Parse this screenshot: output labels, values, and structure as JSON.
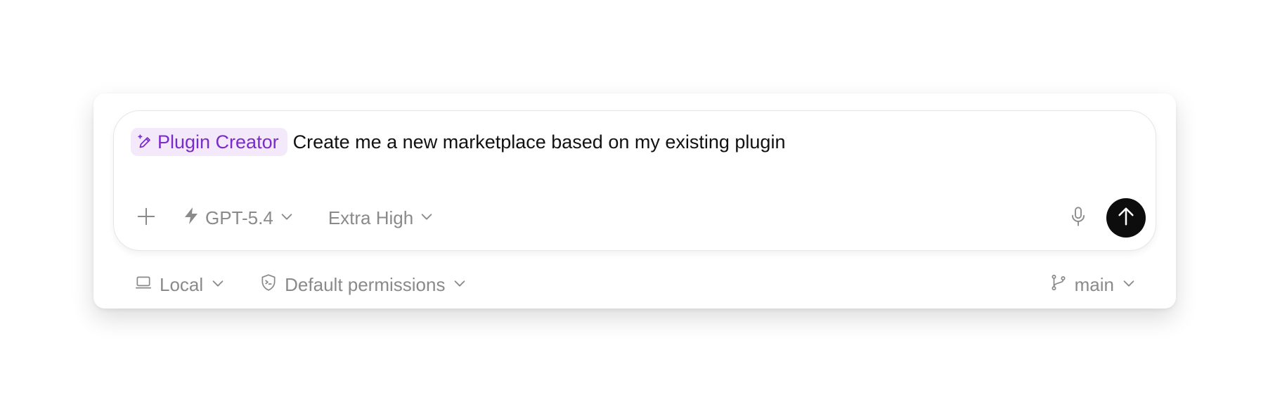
{
  "composer": {
    "skill_chip": {
      "label": "Plugin Creator",
      "icon": "pencil-sparkle-icon"
    },
    "prompt_text": "Create me a new marketplace based on my existing plugin",
    "toolbar": {
      "add_icon": "plus-icon",
      "model": {
        "icon": "bolt-icon",
        "label": "GPT-5.4"
      },
      "reasoning": {
        "label": "Extra High"
      },
      "mic_icon": "microphone-icon",
      "send_icon": "arrow-up-icon"
    }
  },
  "footer": {
    "environment": {
      "icon": "laptop-icon",
      "label": "Local"
    },
    "permissions": {
      "icon": "shield-terminal-icon",
      "label": "Default permissions"
    },
    "branch": {
      "icon": "git-branch-icon",
      "label": "main"
    }
  },
  "colors": {
    "accent_purple": "#7a2cc9",
    "chip_background": "#f3e9fb",
    "muted_text": "#8a8a8a",
    "send_button": "#0d0d0d"
  }
}
